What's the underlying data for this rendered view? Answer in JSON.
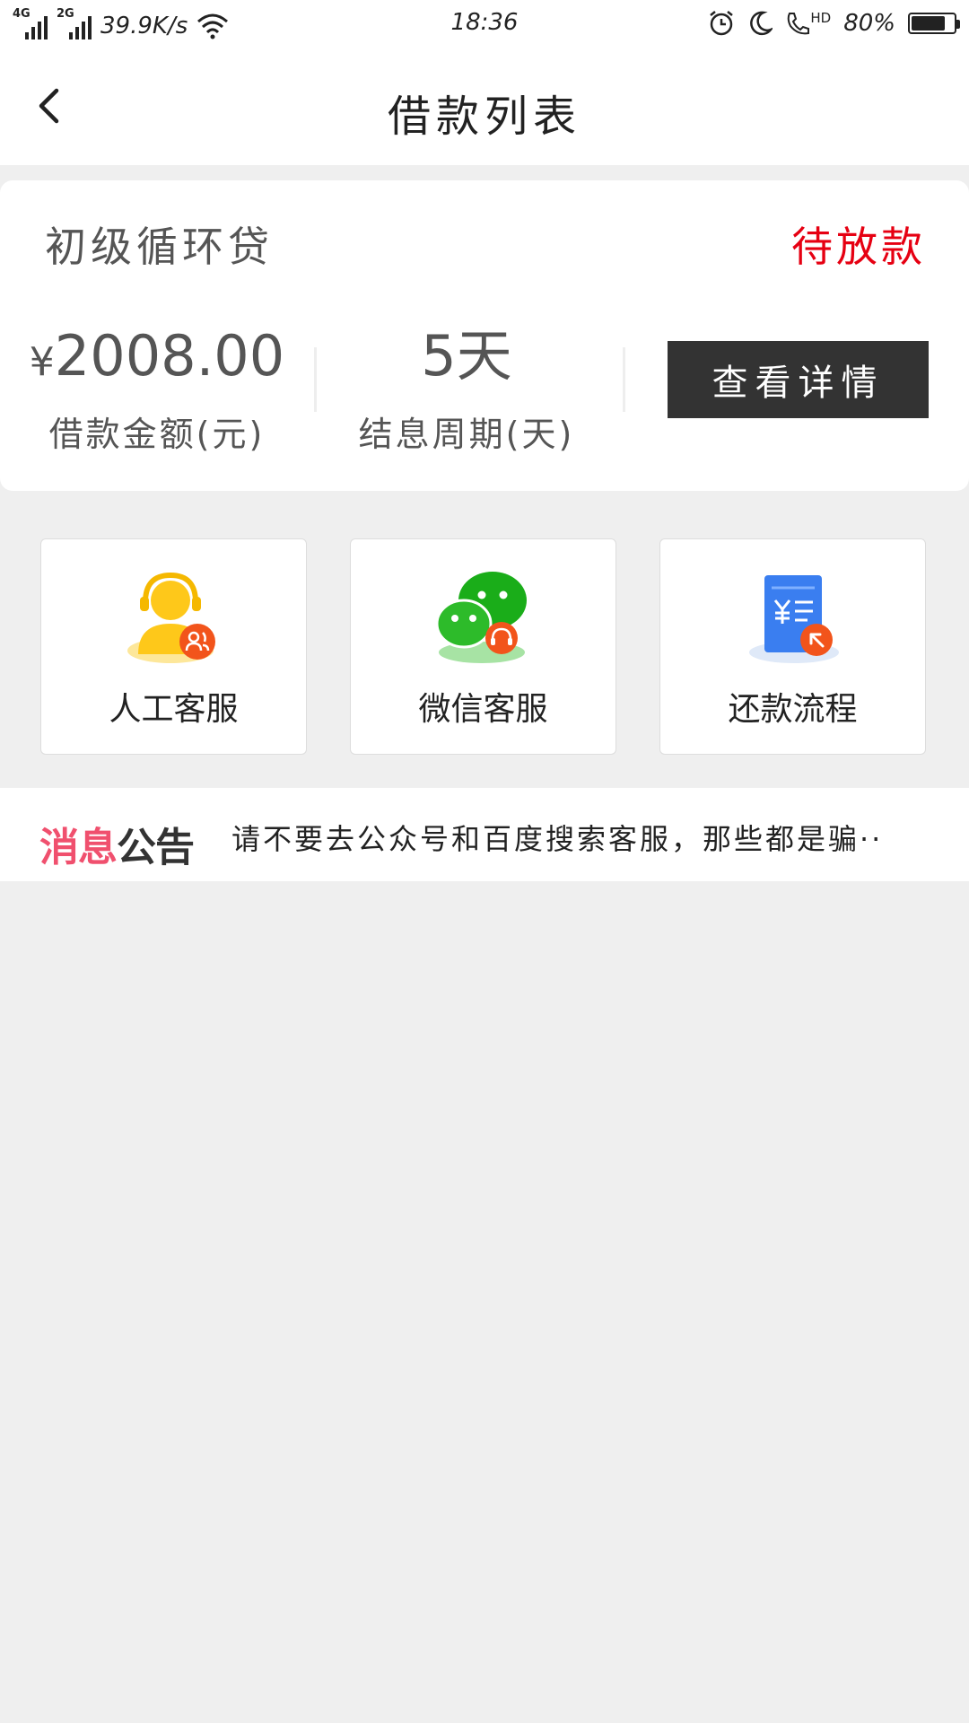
{
  "status_bar": {
    "net1": "4G",
    "net2": "2G",
    "speed": "39.9K/s",
    "time": "18:36",
    "hd": "HD",
    "battery_text": "80%",
    "battery_level": 0.8
  },
  "header": {
    "title": "借款列表"
  },
  "loan": {
    "product_name": "初级循环贷",
    "status": "待放款",
    "status_color": "#e60012",
    "currency": "¥",
    "amount": "2008.00",
    "amount_label": "借款金额(元)",
    "period": "5天",
    "period_label": "结息周期(天)",
    "detail_button": "查看详情"
  },
  "services": [
    {
      "label": "人工客服",
      "icon": "customer-service-icon"
    },
    {
      "label": "微信客服",
      "icon": "wechat-service-icon"
    },
    {
      "label": "还款流程",
      "icon": "repayment-process-icon"
    }
  ],
  "notice": {
    "badge_part1": "消息",
    "badge_part2": "公告",
    "text": "请不要去公众号和百度搜索客服，那些都是骗··"
  },
  "colors": {
    "accent_red": "#e60012",
    "button_dark": "#333333",
    "background": "#efefef"
  }
}
